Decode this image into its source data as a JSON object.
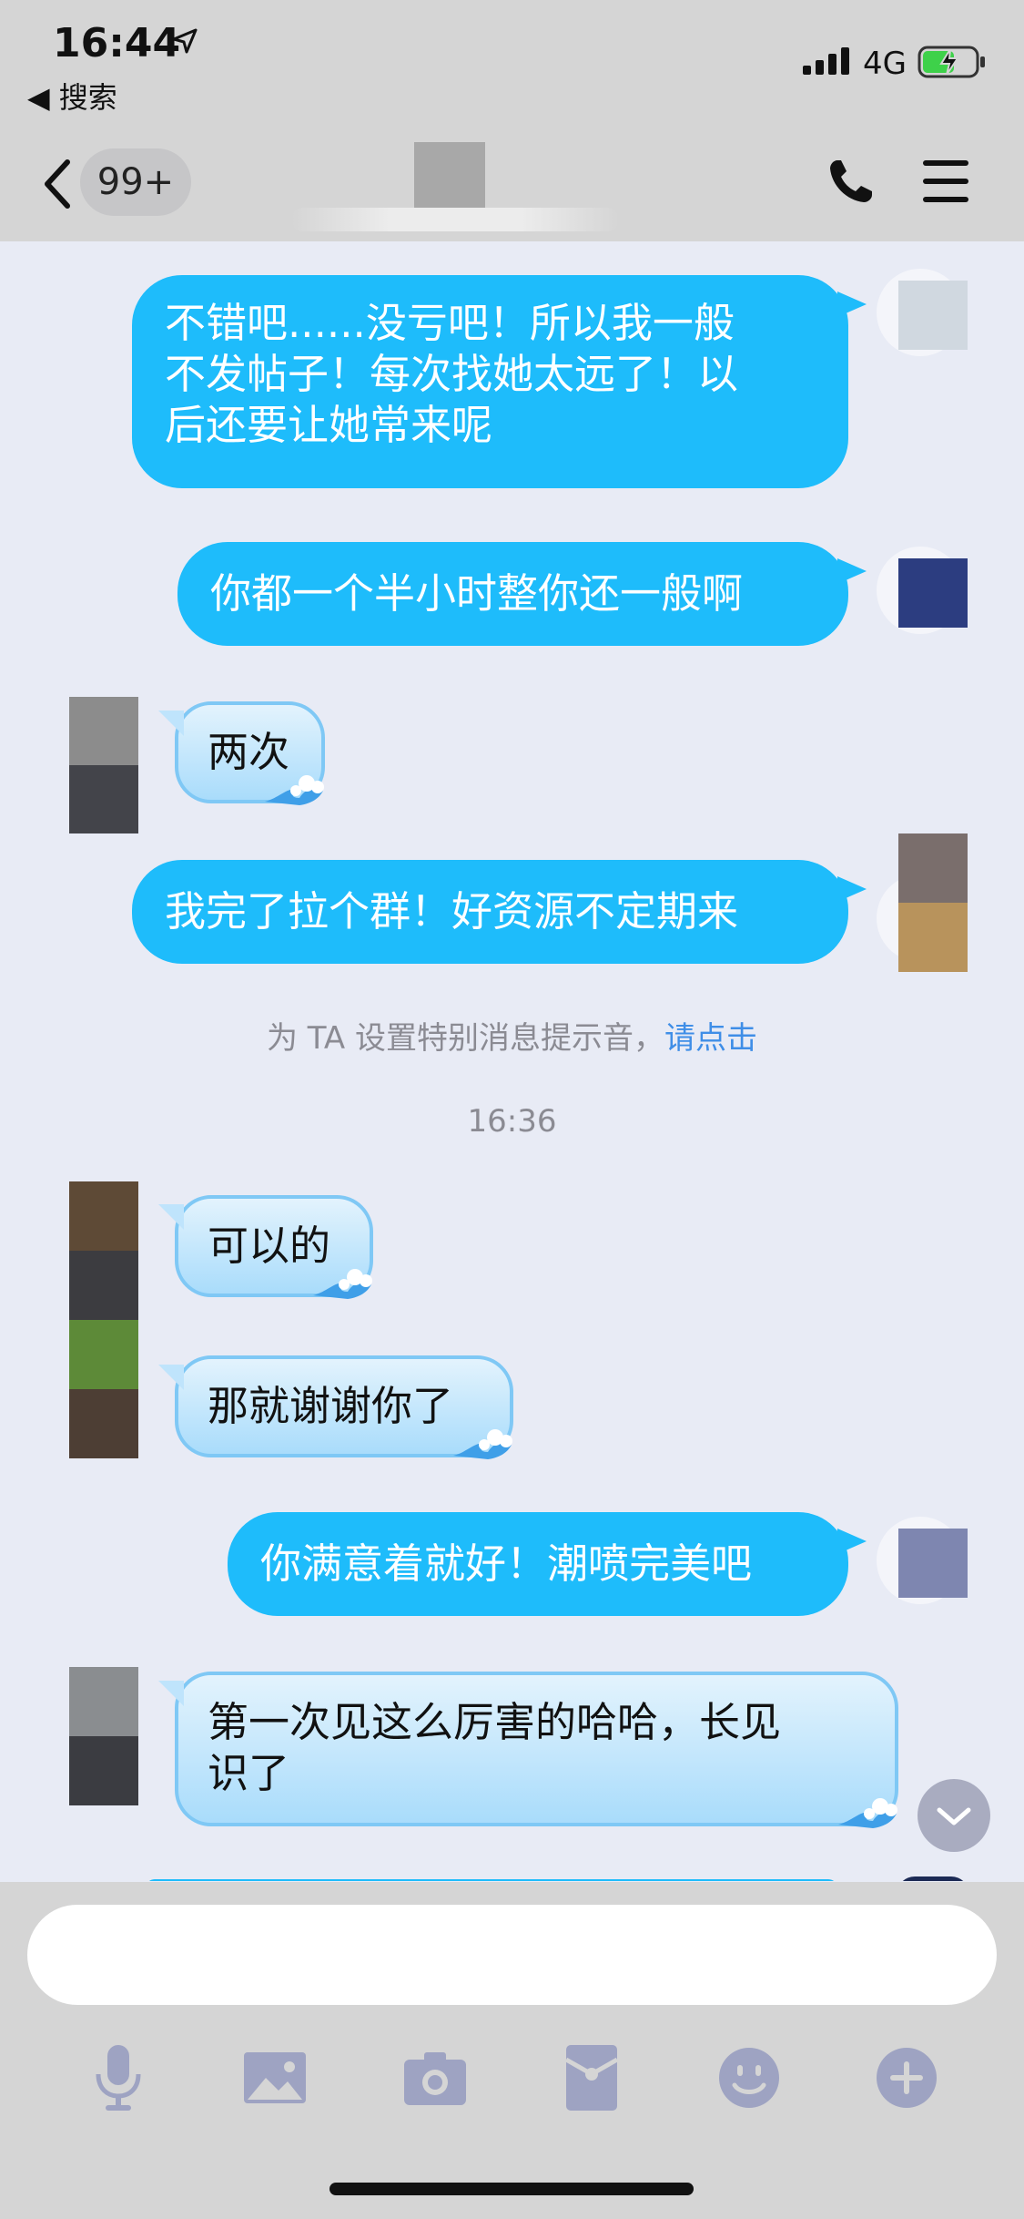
{
  "status_bar": {
    "time": "16:44",
    "back_app": "◀ 搜索",
    "network": "4G"
  },
  "header": {
    "unread_count": "99+"
  },
  "colors": {
    "outgoing_bubble": "#1ebcfb",
    "incoming_bubble_top": "#e3f3fd",
    "incoming_bubble_bottom": "#a9dcfb",
    "link": "#3f8ee7",
    "bar_background": "#d5d5d5",
    "chat_background": "#e8ebf5"
  },
  "messages": [
    {
      "direction": "outgoing",
      "lines": [
        "不错吧......没亏吧！所以我一般",
        "不发帖子！每次找她太远了！以",
        "后还要让她常来呢"
      ]
    },
    {
      "direction": "outgoing",
      "lines": [
        "你都一个半小时整你还一般啊"
      ]
    },
    {
      "direction": "incoming",
      "lines": [
        "两次"
      ]
    },
    {
      "direction": "outgoing",
      "lines": [
        "我完了拉个群！好资源不定期来"
      ]
    },
    {
      "direction": "incoming",
      "lines": [
        "可以的"
      ]
    },
    {
      "direction": "incoming",
      "lines": [
        "那就谢谢你了"
      ]
    },
    {
      "direction": "outgoing",
      "lines": [
        "你满意着就好！潮喷完美吧"
      ]
    },
    {
      "direction": "incoming",
      "lines": [
        "第一次见这么厉害的哈哈，长见",
        "识了"
      ]
    }
  ],
  "system_notice": {
    "text": "为 TA 设置特别消息提示音，",
    "link": "请点击"
  },
  "timestamp": "16:36",
  "input": {
    "placeholder": ""
  },
  "toolbar": {
    "icons": [
      "microphone-icon",
      "image-icon",
      "camera-icon",
      "red-packet-icon",
      "emoji-icon",
      "plus-icon"
    ]
  }
}
